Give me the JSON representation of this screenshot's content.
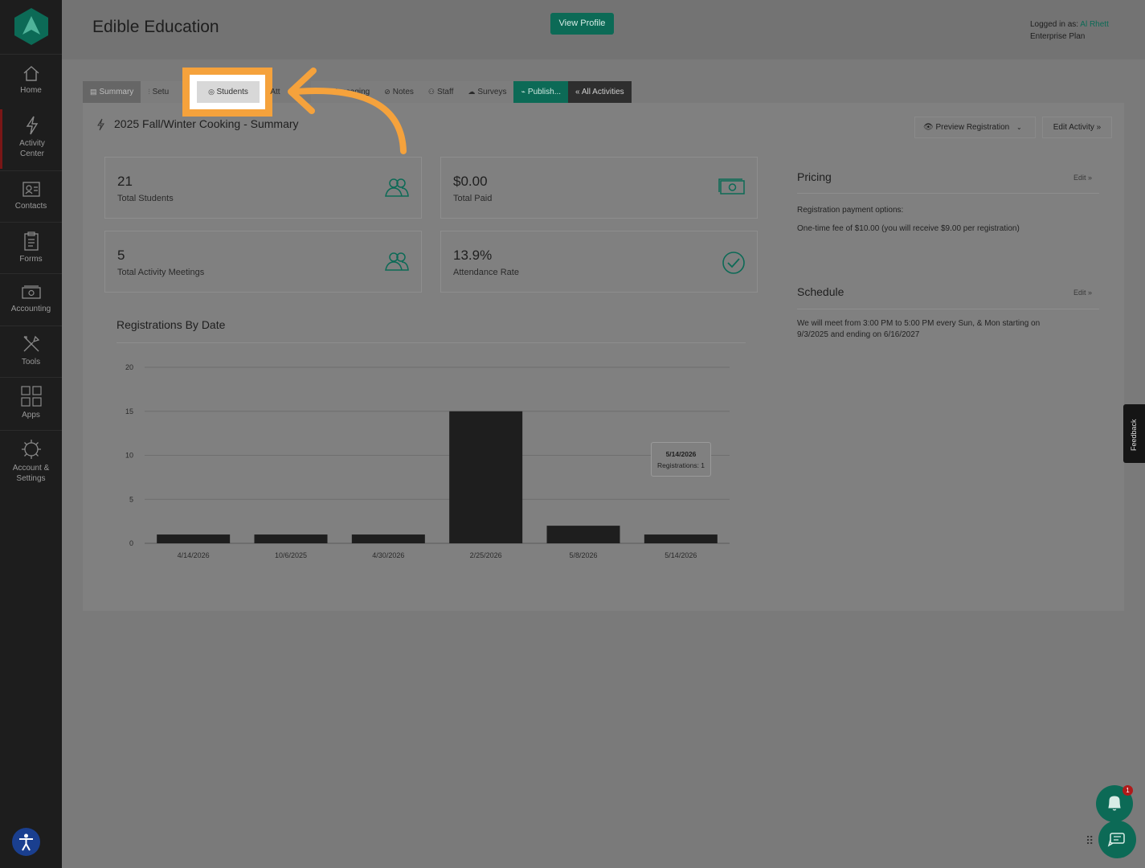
{
  "sidebar": {
    "items": [
      {
        "label": "Home",
        "icon": "home-icon"
      },
      {
        "label": "Activity Center",
        "icon": "bolt-icon"
      },
      {
        "label": "Contacts",
        "icon": "contacts-icon"
      },
      {
        "label": "Forms",
        "icon": "clipboard-icon"
      },
      {
        "label": "Accounting",
        "icon": "money-icon"
      },
      {
        "label": "Tools",
        "icon": "tools-icon"
      },
      {
        "label": "Apps",
        "icon": "grid-icon"
      },
      {
        "label": "Account & Settings",
        "icon": "gear-icon"
      }
    ]
  },
  "header": {
    "title": "Edible Education",
    "view_profile": "View Profile",
    "logged_in_prefix": "Logged in as: ",
    "user": "Al Rhett",
    "plan": "Enterprise Plan"
  },
  "tabs": [
    {
      "label": "Summary"
    },
    {
      "label": "Setu"
    },
    {
      "label": "Students"
    },
    {
      "label": "Att"
    },
    {
      "label": "Messaging"
    },
    {
      "label": "Notes"
    },
    {
      "label": "Staff"
    },
    {
      "label": "Surveys"
    },
    {
      "label": "Publish..."
    },
    {
      "label": "« All Activities"
    }
  ],
  "activity": {
    "title": "2025 Fall/Winter Cooking - Summary",
    "preview_button": "Preview Registration",
    "edit_button": "Edit Activity »"
  },
  "stats": [
    {
      "value": "21",
      "label": "Total Students"
    },
    {
      "value": "$0.00",
      "label": "Total Paid"
    },
    {
      "value": "5",
      "label": "Total Activity Meetings"
    },
    {
      "value": "13.9%",
      "label": "Attendance Rate"
    }
  ],
  "pricing": {
    "title": "Pricing",
    "edit": "Edit »",
    "options_label": "Registration payment options:",
    "fee_text": "One-time fee of $10.00 (you will receive $9.00 per registration)"
  },
  "schedule": {
    "title": "Schedule",
    "edit": "Edit »",
    "line1": "We will meet from 3:00 PM to 5:00 PM every Sun, & Mon starting on",
    "line2": "9/3/2025 and ending on 6/16/2027"
  },
  "chart_data": {
    "type": "bar",
    "title": "Registrations By Date",
    "categories": [
      "4/14/2026",
      "10/6/2025",
      "4/30/2026",
      "2/25/2026",
      "5/8/2026",
      "5/14/2026"
    ],
    "series": [
      {
        "name": "Registrations",
        "values": [
          1,
          1,
          1,
          15,
          2,
          1
        ]
      }
    ],
    "ylim": [
      0,
      20
    ],
    "yticks": [
      0,
      5,
      10,
      15,
      20
    ],
    "grid": true,
    "tooltip": {
      "date": "5/14/2026",
      "text": "Registrations: 1"
    }
  },
  "feedback": "Feedback",
  "notification_count": "1",
  "colors": {
    "accent": "#0c6a56",
    "highlight": "#f5a23c",
    "sidebar": "#1d1d1d"
  }
}
